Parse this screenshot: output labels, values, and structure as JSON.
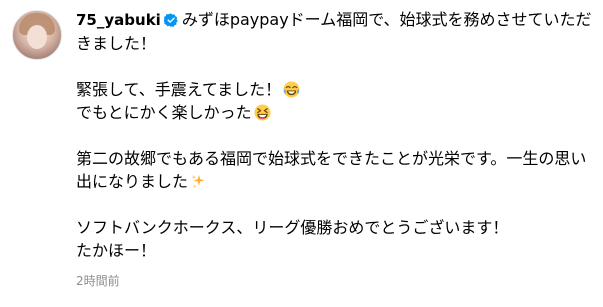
{
  "post": {
    "username": "75_yabuki",
    "caption_p1": "みずほpaypayドーム福岡で、始球式を務めさせていただきました！",
    "caption_p2_line1": "緊張して、手震えてました！",
    "caption_p2_line2": "でもとにかく楽しかった",
    "caption_p3": "第二の故郷でもある福岡で始球式をできたことが光栄です。一生の思い出になりました",
    "caption_p4_line1": "ソフトバンクホークス、リーグ優勝おめでとうございます！",
    "caption_p4_line2": "たかほー！",
    "timestamp": "2時間前"
  },
  "icons": {
    "verified": "verified-badge-icon",
    "emoji_1": "joy-emoji-icon",
    "emoji_2": "grinning-squinting-emoji-icon",
    "emoji_3": "sparkles-emoji-icon"
  },
  "colors": {
    "verified_blue": "#0095f6",
    "timestamp_gray": "#8e8e8e",
    "text": "#000000"
  }
}
